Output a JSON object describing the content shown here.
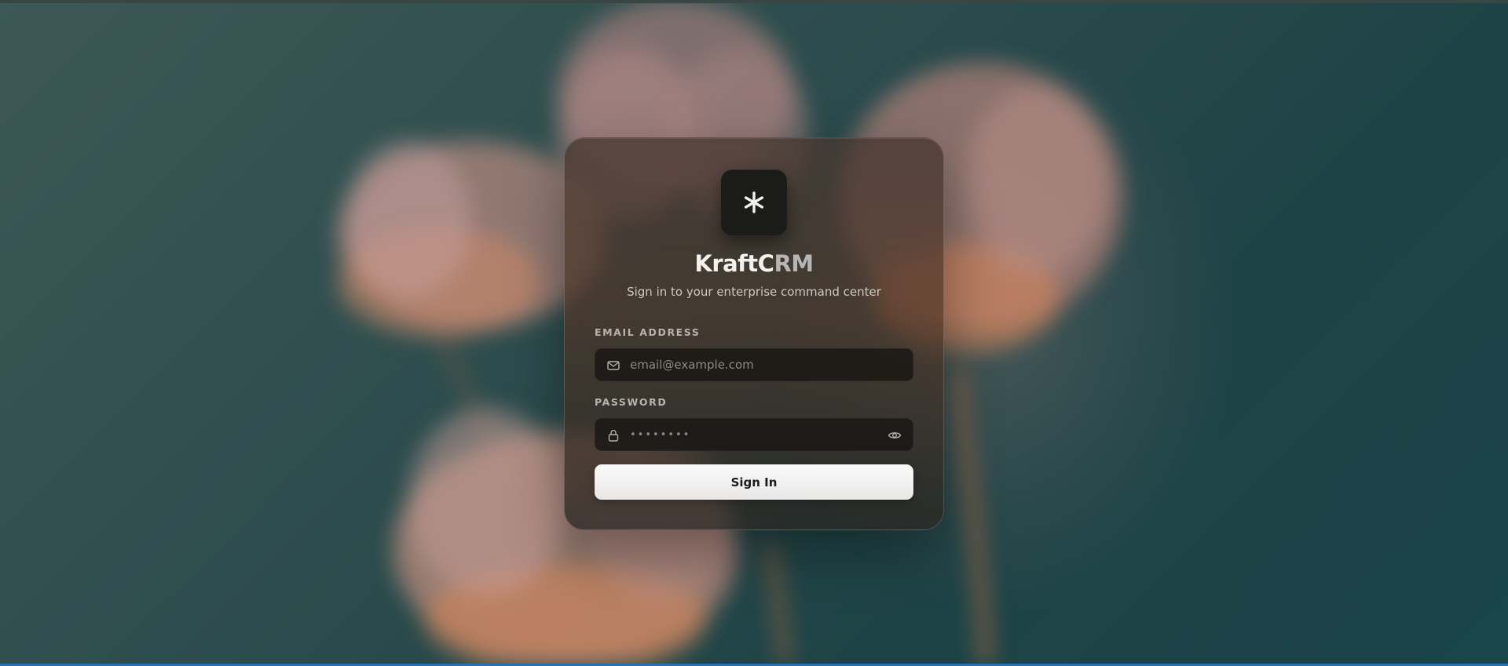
{
  "brand": {
    "name_primary": "KraftC",
    "name_secondary": "RM",
    "logo_icon": "asterisk-icon"
  },
  "subtitle": "Sign in to your enterprise command center",
  "form": {
    "email": {
      "label": "EMAIL ADDRESS",
      "placeholder": "email@example.com",
      "value": "",
      "icon": "mail-icon"
    },
    "password": {
      "label": "PASSWORD",
      "masked_value": "••••••••",
      "icon": "lock-icon",
      "toggle_icon": "eye-icon"
    },
    "submit_label": "Sign In"
  },
  "colors": {
    "background_teal": "#1e4346",
    "card_brown": "#4e3426",
    "input_bg": "#181614",
    "button_bg": "#f5f4f3",
    "accent_text": "#f3f1ee"
  }
}
